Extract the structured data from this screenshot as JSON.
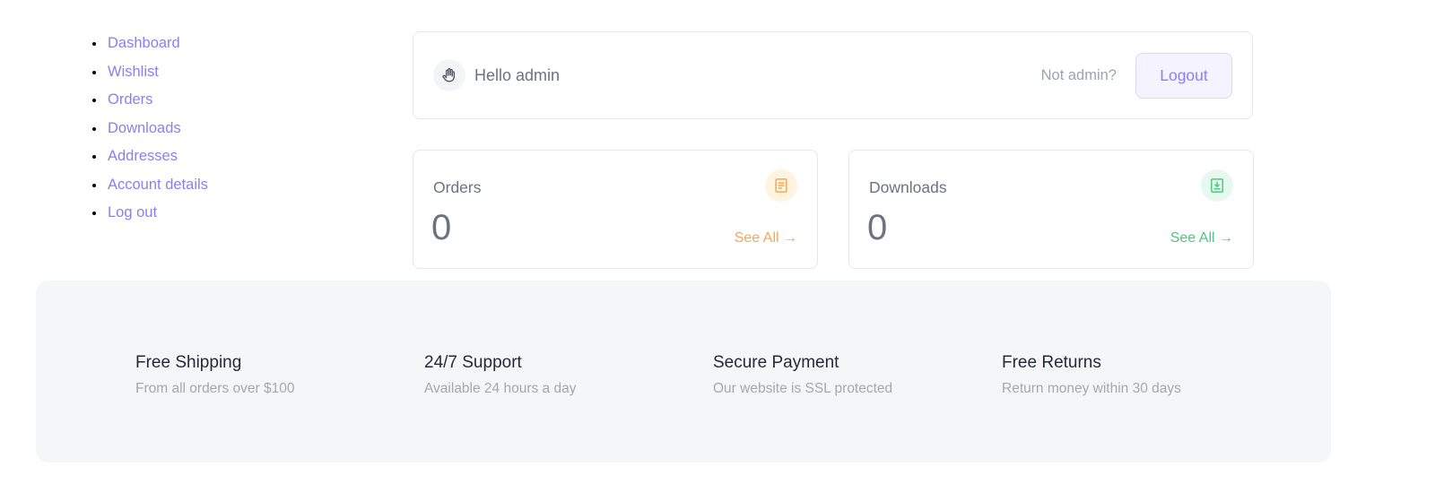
{
  "nav": {
    "items": [
      {
        "label": "Dashboard"
      },
      {
        "label": "Wishlist"
      },
      {
        "label": "Orders"
      },
      {
        "label": "Downloads"
      },
      {
        "label": "Addresses"
      },
      {
        "label": "Account details"
      },
      {
        "label": "Log out"
      }
    ]
  },
  "greeting": {
    "icon": "waving-hand-icon",
    "text": "Hello admin",
    "not_admin_text": "Not admin?",
    "logout_label": "Logout"
  },
  "stats": {
    "orders": {
      "label": "Orders",
      "value": "0",
      "link_label": "See All →",
      "icon": "document-icon",
      "accent": "#f4a65a"
    },
    "downloads": {
      "label": "Downloads",
      "value": "0",
      "link_label": "See All →",
      "icon": "download-icon",
      "accent": "#4cc880"
    }
  },
  "features": [
    {
      "title": "Free Shipping",
      "subtitle": "From all orders over $100"
    },
    {
      "title": "24/7 Support",
      "subtitle": "Available 24 hours a day"
    },
    {
      "title": "Secure Payment",
      "subtitle": "Our website is SSL protected"
    },
    {
      "title": "Free Returns",
      "subtitle": "Return money within 30 days"
    }
  ],
  "colors": {
    "link": "#8b7ff0",
    "panel_bg": "#f5f6f8"
  }
}
